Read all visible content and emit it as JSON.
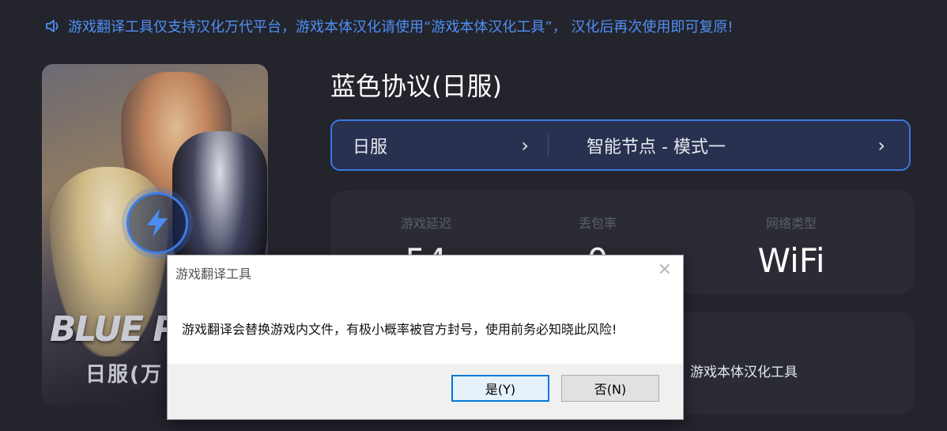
{
  "notice": {
    "text": "游戏翻译工具仅支持汉化万代平台，游戏本体汉化请使用“游戏本体汉化工具”， 汉化后再次使用即可复原!",
    "icon": "speaker-icon",
    "color": "#4f8ff5"
  },
  "cover": {
    "logo_text": "BLUE PRO",
    "sub_text": "日服(万",
    "boost_icon": "lightning-icon"
  },
  "game": {
    "title": "蓝色协议(日服)"
  },
  "server_selector": {
    "region": "日服",
    "node": "智能节点 - 模式一",
    "accent": "#3b78e0"
  },
  "stats": [
    {
      "caption": "游戏延迟",
      "value": "54"
    },
    {
      "caption": "丢包率",
      "value": "0"
    },
    {
      "caption": "网络类型",
      "value": "WiFi"
    }
  ],
  "tools": {
    "label": "游戏本体汉化工具"
  },
  "dialog": {
    "title": "游戏翻译工具",
    "message": "游戏翻译会替换游戏内文件，有极小概率被官方封号，使用前务必知晓此风险!",
    "yes_label": "是(Y)",
    "no_label": "否(N)",
    "close_icon": "close-icon"
  }
}
